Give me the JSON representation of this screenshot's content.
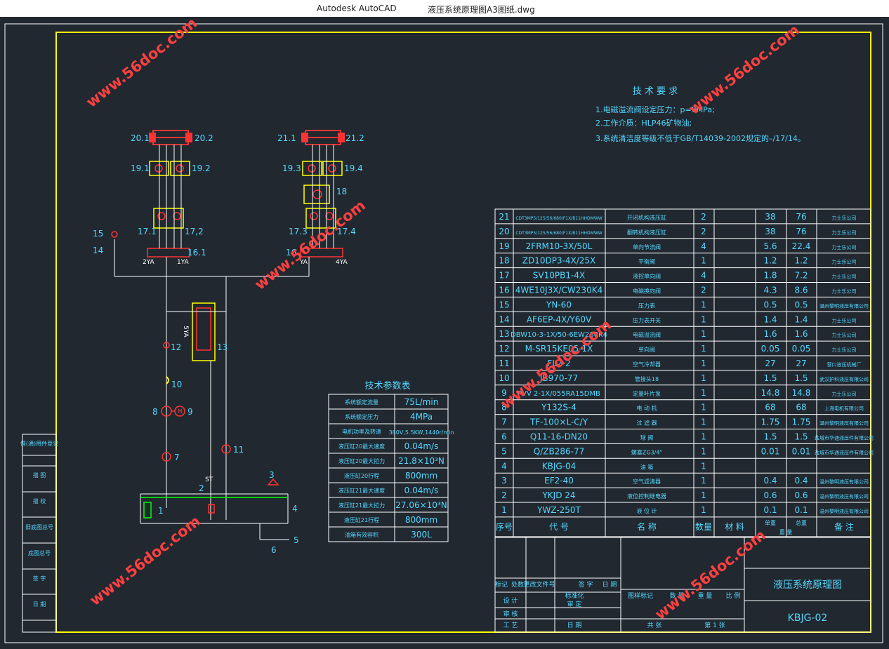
{
  "window": {
    "app": "Autodesk AutoCAD",
    "file": "液压系统原理图A3图纸.dwg"
  },
  "watermark": "www.56doc.com",
  "colors": {
    "background": "#212830",
    "frame": "#ffff00",
    "lines": "#ffffff",
    "labels": "#56d8ff",
    "components": "#ff3333"
  },
  "tech_requirements": {
    "title": "技 术 要 求",
    "items": [
      "1.电磁溢流阀设定压力：p=5MPa;",
      "2.工作介质：HLP46矿物油;",
      "3.系统清洁度等级不低于GB/T14039-2002规定的–/17/14。"
    ]
  },
  "labels": {
    "c20_1": "20.1",
    "c20_2": "20.2",
    "c21_1": "21.1",
    "c21_2": "21.2",
    "c19_1": "19.1",
    "c19_2": "19.2",
    "c19_3": "19.3",
    "c19_4": "19.4",
    "c18": "18",
    "c17_1": "17.1",
    "c17_2": "17,2",
    "c17_3": "17.3",
    "c17_4": "17.4",
    "c15": "15",
    "c14": "14",
    "c16_1": "16.1",
    "c16_2": "16",
    "y2": "2YA",
    "y1": "1YA",
    "y3": "YA",
    "y4": "4YA",
    "y5": "5YA",
    "c12": "12",
    "c13": "13",
    "c10": "10",
    "c8": "8",
    "c9": "9",
    "c7": "7",
    "c11": "11",
    "st": "ST",
    "c2": "2",
    "c3": "3",
    "c1": "1",
    "c4": "4",
    "c5": "5",
    "c6": "6",
    "motor": "M"
  },
  "params": {
    "title": "技术参数表",
    "rows": [
      {
        "k": "系统额定流量",
        "v": "75L/min"
      },
      {
        "k": "系统额定压力",
        "v": "4MPa"
      },
      {
        "k": "电机功率及转速",
        "v": "380V,5.5KW,1440r/min"
      },
      {
        "k": "液压缸20最大速度",
        "v": "0.04m/s"
      },
      {
        "k": "液压缸20最大拉力",
        "v": "21.8×10³N"
      },
      {
        "k": "液压缸20行程",
        "v": "800mm"
      },
      {
        "k": "液压缸21最大速度",
        "v": "0.04m/s"
      },
      {
        "k": "液压缸21最大拉力",
        "v": "27.06×10³N"
      },
      {
        "k": "液压缸21行程",
        "v": "800mm"
      },
      {
        "k": "油箱有效容积",
        "v": "300L"
      }
    ]
  },
  "bom": {
    "rows": [
      {
        "n": "21",
        "code": "CDT3MP5/125/56/680/F1X/B11HHDMWW",
        "name": "开闭机构液压缸",
        "qty": "2",
        "mat": "",
        "w1": "38",
        "w2": "76",
        "note": "力士乐公司"
      },
      {
        "n": "20",
        "code": "CDT3MP5/125/56/680/F1X/B11HHDMWW",
        "name": "翻转机构液压缸",
        "qty": "2",
        "mat": "",
        "w1": "38",
        "w2": "76",
        "note": "力士乐公司"
      },
      {
        "n": "19",
        "code": "2FRM10-3X/50L",
        "name": "单向节流阀",
        "qty": "4",
        "mat": "",
        "w1": "5.6",
        "w2": "22.4",
        "note": "力士乐公司"
      },
      {
        "n": "18",
        "code": "ZD10DP3-4X/25X",
        "name": "平衡阀",
        "qty": "1",
        "mat": "",
        "w1": "1.2",
        "w2": "1.2",
        "note": "力士乐公司"
      },
      {
        "n": "17",
        "code": "SV10PB1-4X",
        "name": "液控单向阀",
        "qty": "4",
        "mat": "",
        "w1": "1.8",
        "w2": "7.2",
        "note": "力士乐公司"
      },
      {
        "n": "16",
        "code": "4WE10J3X/CW230K4",
        "name": "电磁换向阀",
        "qty": "2",
        "mat": "",
        "w1": "4.3",
        "w2": "8.6",
        "note": "力士乐公司"
      },
      {
        "n": "15",
        "code": "YN-60",
        "name": "压力表",
        "qty": "1",
        "mat": "",
        "w1": "0.5",
        "w2": "0.5",
        "note": "温州黎明液压有限公司"
      },
      {
        "n": "14",
        "code": "AF6EP-4X/Y60V",
        "name": "压力表开关",
        "qty": "1",
        "mat": "",
        "w1": "1.4",
        "w2": "1.4",
        "note": "力士乐公司"
      },
      {
        "n": "13",
        "code": "DBW10-3-1X/50-6EW230K4",
        "name": "电磁溢流阀",
        "qty": "1",
        "mat": "",
        "w1": "1.6",
        "w2": "1.6",
        "note": "力士乐公司"
      },
      {
        "n": "12",
        "code": "M-SR15KE05-1X",
        "name": "单向阀",
        "qty": "1",
        "mat": "",
        "w1": "0.05",
        "w2": "0.05",
        "note": "力士乐公司"
      },
      {
        "n": "11",
        "code": "FL2-2",
        "name": "空气冷却器",
        "qty": "1",
        "mat": "",
        "w1": "27",
        "w2": "27",
        "note": "营口液压机械厂"
      },
      {
        "n": "10",
        "code": "JB970-77",
        "name": "管接头18",
        "qty": "1",
        "mat": "",
        "w1": "1.5",
        "w2": "1.5",
        "note": "武汉护科液压有限公司"
      },
      {
        "n": "9",
        "code": "PVV 2-1X/055RA15DMB",
        "name": "定量叶片泵",
        "qty": "1",
        "mat": "",
        "w1": "14.8",
        "w2": "14.8",
        "note": "力士乐公司"
      },
      {
        "n": "8",
        "code": "Y132S-4",
        "name": "电 动 机",
        "qty": "1",
        "mat": "",
        "w1": "68",
        "w2": "68",
        "note": "上海电机有限公司"
      },
      {
        "n": "7",
        "code": "TF-100×L-C/Y",
        "name": "过 滤 器",
        "qty": "1",
        "mat": "",
        "w1": "1.75",
        "w2": "1.75",
        "note": "温州黎明液压有限公司"
      },
      {
        "n": "6",
        "code": "Q11-16-DN20",
        "name": "球 阀",
        "qty": "1",
        "mat": "",
        "w1": "1.5",
        "w2": "1.5",
        "note": "盐城市华通液压件有限公司"
      },
      {
        "n": "5",
        "code": "Q/ZB286-77",
        "name": "螺塞ZG3/4\"",
        "qty": "1",
        "mat": "",
        "w1": "0.01",
        "w2": "0.01",
        "note": "盐城市华通液压件有限公司"
      },
      {
        "n": "4",
        "code": "KBJG-04",
        "name": "油 箱",
        "qty": "1",
        "mat": "",
        "w1": "",
        "w2": "",
        "note": ""
      },
      {
        "n": "3",
        "code": "EF2-40",
        "name": "空气滤清器",
        "qty": "1",
        "mat": "",
        "w1": "0.4",
        "w2": "0.4",
        "note": "温州黎明液压有限公司"
      },
      {
        "n": "2",
        "code": "YKJD 24",
        "name": "液位控制继电器",
        "qty": "1",
        "mat": "",
        "w1": "0.6",
        "w2": "0.6",
        "note": "温州黎明液压有限公司"
      },
      {
        "n": "1",
        "code": "YWZ-250T",
        "name": "液 位 计",
        "qty": "1",
        "mat": "",
        "w1": "0.1",
        "w2": "0.1",
        "note": "温州黎明液压有限公司"
      }
    ],
    "header": {
      "n": "序号",
      "code": "代 号",
      "name": "名 称",
      "qty": "数量",
      "mat": "材 料",
      "w1": "单重",
      "w2": "总重",
      "wt": "重 量",
      "note": "备 注"
    }
  },
  "title_block": {
    "drawing_title": "液压系统原理图",
    "drawing_no": "KBJG-02",
    "rev_headers": [
      "标记",
      "处数",
      "更改文件号",
      "签 字",
      "日 期"
    ],
    "roles": [
      "设 计",
      "审 核",
      "工 艺"
    ],
    "std": "标准化",
    "approve": "审 定",
    "date": "日 期",
    "stage_headers": [
      "图样标记",
      "数 量",
      "重 量",
      "比 例"
    ],
    "sheets": "共    张",
    "sheet": "第 1 张"
  },
  "side_labels": [
    "借(通)用件登记",
    "描 图",
    "描 校",
    "旧底图总号",
    "底图总号",
    "签 字",
    "日 期"
  ]
}
